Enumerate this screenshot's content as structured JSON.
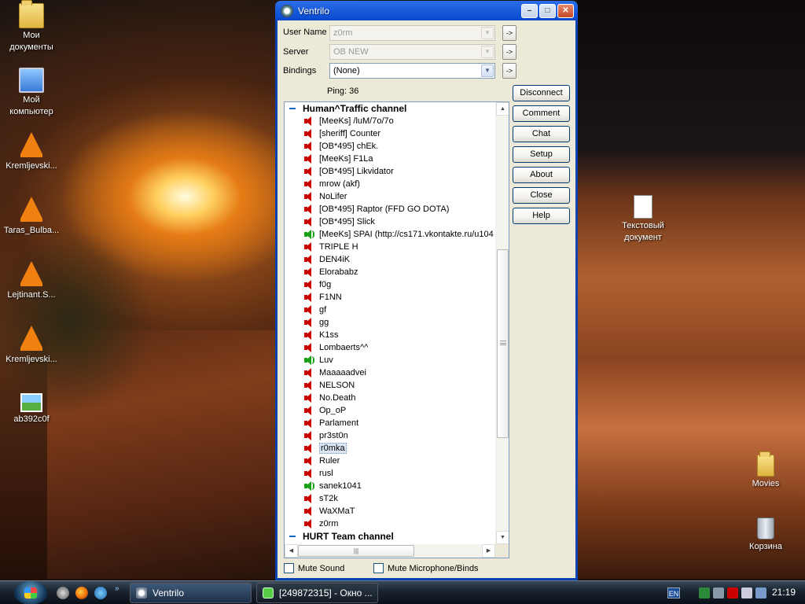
{
  "desktop": {
    "icons": [
      {
        "label": "Мои документы",
        "icon": "folder-icon"
      },
      {
        "label": "Мой компьютер",
        "icon": "computer-icon"
      },
      {
        "label": "Kremljevski...",
        "icon": "vlc-icon"
      },
      {
        "label": "Taras_Bulba...",
        "icon": "vlc-icon"
      },
      {
        "label": "Lejtinant.S...",
        "icon": "vlc-icon"
      },
      {
        "label": "Kremljevski...",
        "icon": "vlc-icon"
      },
      {
        "label": "ab392c0f",
        "icon": "image-file-icon"
      },
      {
        "label": "Текстовый документ",
        "icon": "text-document-icon"
      },
      {
        "label": "Movies",
        "icon": "folder-icon"
      },
      {
        "label": "Корзина",
        "icon": "recycle-bin-icon"
      }
    ]
  },
  "window": {
    "title": "Ventrilo",
    "controls": {
      "minimize": "–",
      "maximize": "□",
      "close": "✕"
    }
  },
  "form": {
    "username_label": "User Name",
    "username_value": "z0rm",
    "server_label": "Server",
    "server_value": "OB NEW",
    "bindings_label": "Bindings",
    "bindings_value": "(None)",
    "go": "->",
    "ping": "Ping: 36"
  },
  "buttons": {
    "disconnect": "Disconnect",
    "comment": "Comment",
    "chat": "Chat",
    "setup": "Setup",
    "about": "About",
    "close": "Close",
    "help": "Help"
  },
  "channels": [
    {
      "name": "Human^Traffic channel"
    },
    {
      "name": "HURT Team channel"
    }
  ],
  "users": [
    {
      "name": "[MeeKs] /luM/7o/7o",
      "talking": false
    },
    {
      "name": "[sheriff] Counter",
      "talking": false
    },
    {
      "name": "[OB*495] chEk.",
      "talking": false
    },
    {
      "name": "[MeeKs] F1La",
      "talking": false
    },
    {
      "name": "[OB*495] Likvidator",
      "talking": false
    },
    {
      "name": "mrow (akf)",
      "talking": false
    },
    {
      "name": "NoLifer",
      "talking": false
    },
    {
      "name": "[OB*495] Raptor (FFD GO DOTA)",
      "talking": false
    },
    {
      "name": "[OB*495] Slick",
      "talking": false
    },
    {
      "name": "[MeeKs] SPAI (http://cs171.vkontakte.ru/u104",
      "talking": true
    },
    {
      "name": "TRIPLE H",
      "talking": false
    },
    {
      "name": "DEN4iK",
      "talking": false
    },
    {
      "name": "Elorababz",
      "talking": false
    },
    {
      "name": "f0g",
      "talking": false
    },
    {
      "name": "F1NN",
      "talking": false
    },
    {
      "name": "gf",
      "talking": false
    },
    {
      "name": "gg",
      "talking": false
    },
    {
      "name": "K1ss",
      "talking": false
    },
    {
      "name": "Lombaerts^^",
      "talking": false
    },
    {
      "name": "Luv",
      "talking": true
    },
    {
      "name": "Maaaaadvei",
      "talking": false
    },
    {
      "name": "NELSON",
      "talking": false
    },
    {
      "name": "No.Death",
      "talking": false
    },
    {
      "name": "Op_oP",
      "talking": false
    },
    {
      "name": "Parlament",
      "talking": false
    },
    {
      "name": "pr3st0n",
      "talking": false
    },
    {
      "name": "r0mka",
      "talking": false,
      "selected": true
    },
    {
      "name": "Ruler",
      "talking": false
    },
    {
      "name": "rusl",
      "talking": false
    },
    {
      "name": "sanek1041",
      "talking": true
    },
    {
      "name": "sT2k",
      "talking": false
    },
    {
      "name": "WaXMaT",
      "talking": false
    },
    {
      "name": "z0rm",
      "talking": false
    }
  ],
  "options": {
    "mute_sound": "Mute Sound",
    "mute_mic": "Mute Microphone/Binds"
  },
  "taskbar": {
    "tasks": [
      "Ventrilo",
      "[249872315] - Окно ..."
    ],
    "lang": "EN",
    "clock": "21:19"
  },
  "colors": {
    "titlebar": "#0a4ad0",
    "speaker_idle": "#cc0000",
    "speaker_talking": "#18a018"
  }
}
